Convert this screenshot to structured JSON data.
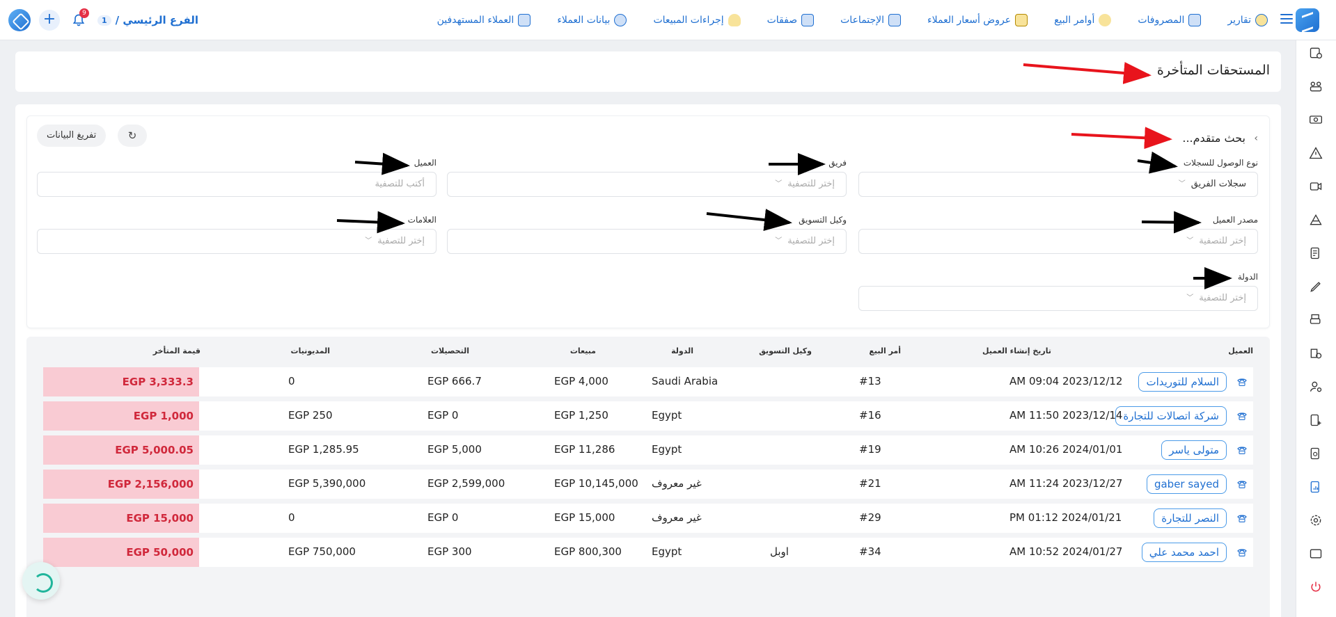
{
  "header": {
    "branch_name": "الفرع الرئيسي /",
    "branch_number": "1",
    "notification_count": "9",
    "nav": [
      {
        "label": "العملاء المستهدفين",
        "icon": "target-customers-icon",
        "color": "#1f6fd1"
      },
      {
        "label": "بيانات العملاء",
        "icon": "customer-data-icon",
        "color": "#1f6fd1"
      },
      {
        "label": "إجراءات المبيعات",
        "icon": "sales-actions-icon",
        "color": "#d9a400"
      },
      {
        "label": "صفقات",
        "icon": "deals-icon",
        "color": "#1f6fd1"
      },
      {
        "label": "الإجتماعات",
        "icon": "meetings-icon",
        "color": "#1f6fd1"
      },
      {
        "label": "عروض أسعار العملاء",
        "icon": "quotes-icon",
        "color": "#d9a400"
      },
      {
        "label": "أوامر البيع",
        "icon": "sales-orders-icon",
        "color": "#d9a400"
      },
      {
        "label": "المصروفات",
        "icon": "expenses-icon",
        "color": "#1f6fd1"
      },
      {
        "label": "تقارير",
        "icon": "reports-icon",
        "color": "#d9a400"
      }
    ]
  },
  "page": {
    "title": "المستحقات المتأخرة"
  },
  "filters": {
    "advanced_search_label": "بحث متقدم...",
    "reset_label": "تفريغ البيانات",
    "access_type": {
      "label": "نوع الوصول للسجلات",
      "value": "سجلات الفريق"
    },
    "team": {
      "label": "فريق",
      "placeholder": "إختر للتصفية"
    },
    "customer": {
      "label": "العميل",
      "placeholder": "أكتب للتصفية"
    },
    "customer_source": {
      "label": "مصدر العميل",
      "placeholder": "إختر للتصفية"
    },
    "marketing_agent": {
      "label": "وكيل التسويق",
      "placeholder": "إختر للتصفية"
    },
    "tags": {
      "label": "العلامات",
      "placeholder": "إختر للتصفية"
    },
    "country": {
      "label": "الدولة",
      "placeholder": "إختر للتصفية"
    }
  },
  "table": {
    "headers": {
      "customer": "العميل",
      "created": "تاريخ إنشاء العميل",
      "order": "أمر البيع",
      "agent": "وكيل التسويق",
      "country": "الدولة",
      "sales": "مبيعات",
      "collections": "التحصيلات",
      "debts": "المديونيات",
      "late_value": "قيمة المتأخر"
    },
    "rows": [
      {
        "customer": "السلام للتوريدات",
        "created": "2023/12/12 09:04 AM",
        "order": "#13",
        "agent": "",
        "country": "Saudi Arabia",
        "sales": "EGP 4,000",
        "collections": "EGP 666.7",
        "debts": "0",
        "late": "EGP 3,333.3"
      },
      {
        "customer": "شركة اتصالات للتجارة",
        "created": "2023/12/14 11:50 AM",
        "order": "#16",
        "agent": "",
        "country": "Egypt",
        "sales": "EGP 1,250",
        "collections": "EGP 0",
        "debts": "EGP 250",
        "late": "EGP 1,000"
      },
      {
        "customer": "متولى ياسر",
        "created": "2024/01/01 10:26 AM",
        "order": "#19",
        "agent": "",
        "country": "Egypt",
        "sales": "EGP 11,286",
        "collections": "EGP 5,000",
        "debts": "EGP 1,285.95",
        "late": "EGP 5,000.05"
      },
      {
        "customer": "gaber sayed",
        "created": "2023/12/27 11:24 AM",
        "order": "#21",
        "agent": "",
        "country": "غير معروف",
        "sales": "EGP 10,145,000",
        "collections": "EGP 2,599,000",
        "debts": "EGP 5,390,000",
        "late": "EGP 2,156,000"
      },
      {
        "customer": "النصر للتجارة",
        "created": "2024/01/21 01:12 PM",
        "order": "#29",
        "agent": "",
        "country": "غير معروف",
        "sales": "EGP 15,000",
        "collections": "EGP 0",
        "debts": "0",
        "late": "EGP 15,000"
      },
      {
        "customer": "احمد محمد علي",
        "created": "2024/01/27 10:52 AM",
        "order": "#34",
        "agent": "اوبل",
        "country": "Egypt",
        "sales": "EGP 800,300",
        "collections": "EGP 300",
        "debts": "EGP 750,000",
        "late": "EGP 50,000"
      }
    ]
  },
  "colors": {
    "accent": "#1f6fd1",
    "late_bg": "#f9cbd3",
    "late_text": "#d0283b",
    "arrow_red": "#e8141c",
    "arrow_black": "#000000"
  }
}
